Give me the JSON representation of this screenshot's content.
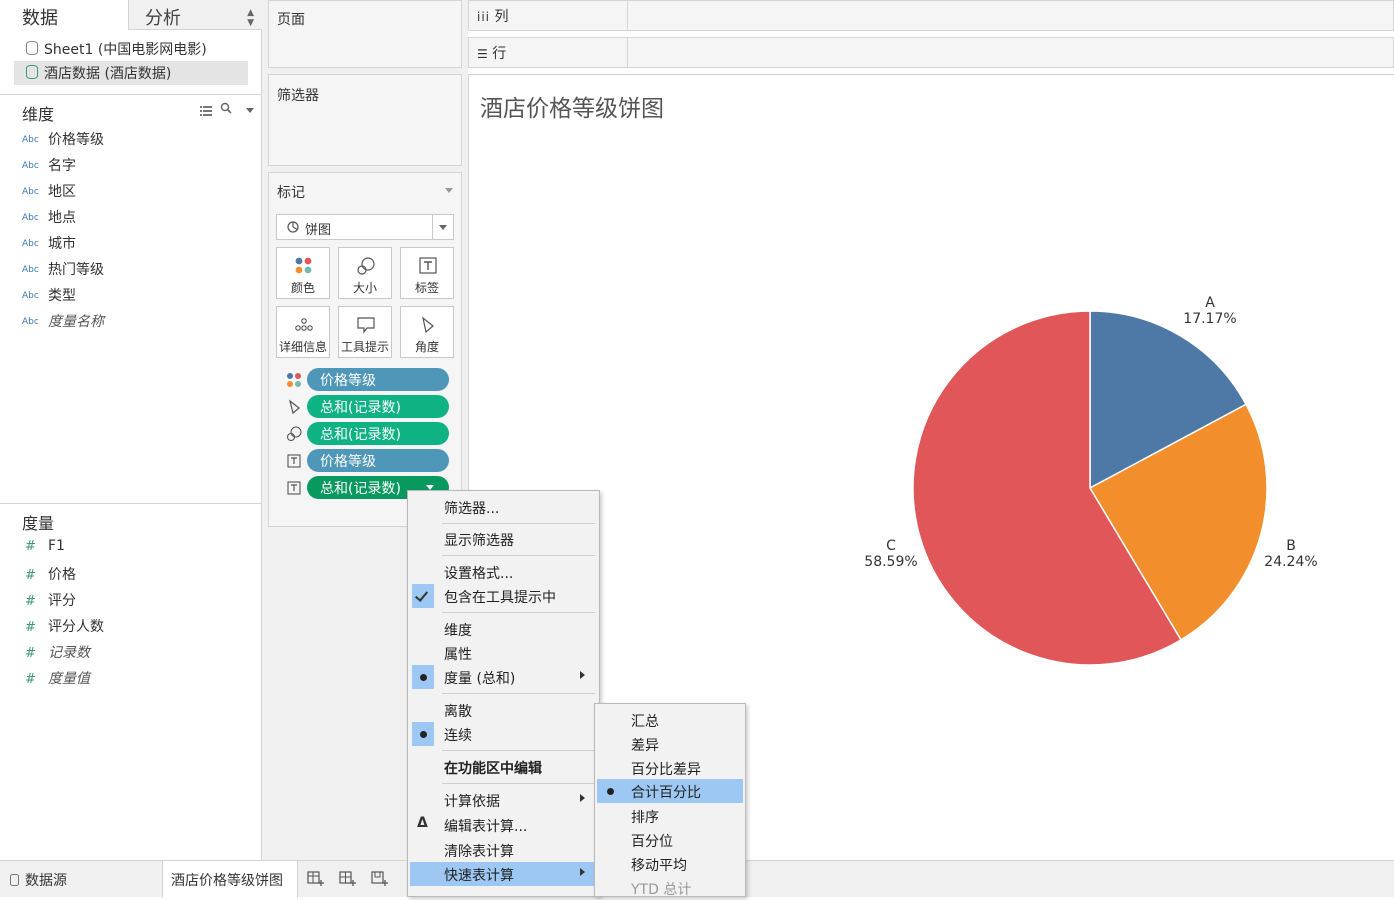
{
  "left_panel": {
    "tabs": {
      "data": "数据",
      "analysis": "分析"
    },
    "datasources": [
      "Sheet1 (中国电影网电影)",
      "酒店数据 (酒店数据)"
    ],
    "dimensions_title": "维度",
    "dimensions": [
      "价格等级",
      "名字",
      "地区",
      "地点",
      "城市",
      "热门等级",
      "类型",
      "度量名称"
    ],
    "dimension_type_tag": "Abc",
    "measures_title": "度量",
    "measures": [
      "F1",
      "价格",
      "评分",
      "评分人数",
      "记录数",
      "度量值"
    ],
    "measure_type_tag": "#"
  },
  "shelves": {
    "pages": "页面",
    "filters": "筛选器",
    "marks": "标记",
    "columns": "列",
    "rows": "行"
  },
  "marks_card": {
    "mark_type": "饼图",
    "buttons": [
      "颜色",
      "大小",
      "标签",
      "详细信息",
      "工具提示",
      "角度"
    ],
    "pills": [
      "价格等级",
      "总和(记录数)",
      "总和(记录数)",
      "价格等级",
      "总和(记录数)"
    ]
  },
  "chart": {
    "title": "酒店价格等级饼图"
  },
  "chart_data": {
    "type": "pie",
    "title": "酒店价格等级饼图",
    "categories": [
      "A",
      "B",
      "C"
    ],
    "values": [
      17.17,
      24.24,
      58.59
    ],
    "value_labels": [
      "17.17%",
      "24.24%",
      "58.59%"
    ],
    "colors": [
      "#4e79a7",
      "#f28e2b",
      "#e15759"
    ]
  },
  "context_menu": {
    "items": [
      "筛选器...",
      "显示筛选器",
      "设置格式...",
      "包含在工具提示中",
      "维度",
      "属性",
      "度量 (总和)",
      "离散",
      "连续",
      "在功能区中编辑",
      "计算依据",
      "编辑表计算...",
      "清除表计算",
      "快速表计算"
    ]
  },
  "submenu": {
    "items": [
      "汇总",
      "差异",
      "百分比差异",
      "合计百分比",
      "排序",
      "百分位",
      "移动平均",
      "YTD 总计"
    ]
  },
  "bottom_bar": {
    "datasource_tab": "数据源",
    "sheet_tab": "酒店价格等级饼图"
  }
}
